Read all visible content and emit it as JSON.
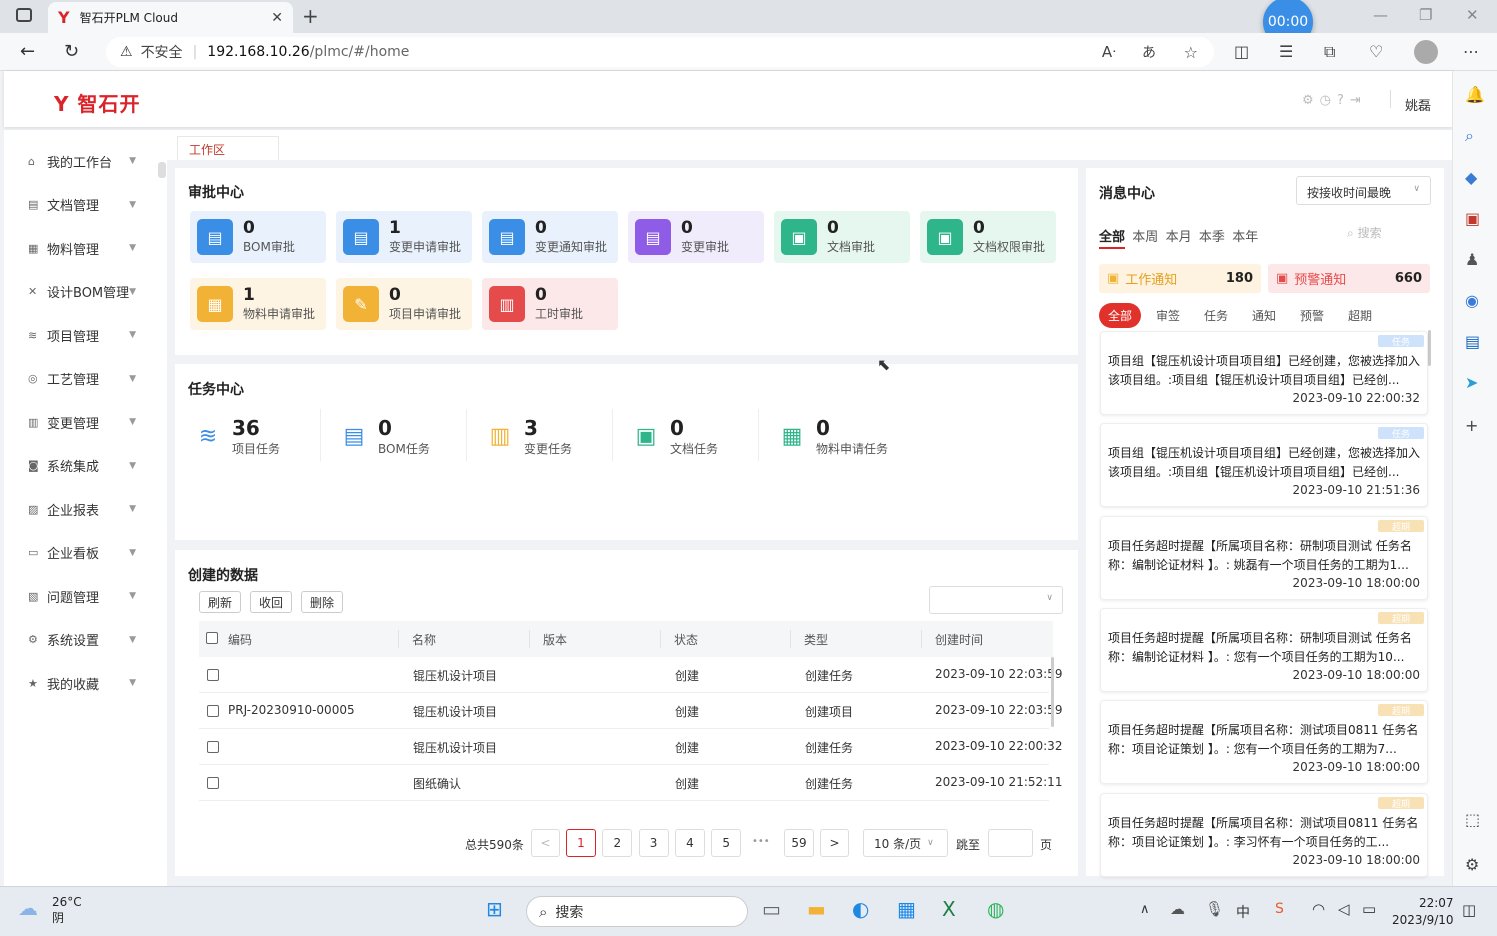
{
  "browser": {
    "tab_title": "智石开PLM Cloud",
    "insecure_label": "不安全",
    "url_host": "192.168.10.26",
    "url_path": "/plmc/#/home",
    "timer": "00:00"
  },
  "header": {
    "logo": "智石开",
    "user": "姚磊"
  },
  "menu": [
    {
      "label": "我的工作台",
      "icon": "home-icon"
    },
    {
      "label": "文档管理",
      "icon": "document-icon"
    },
    {
      "label": "物料管理",
      "icon": "material-icon"
    },
    {
      "label": "设计BOM管理",
      "icon": "bom-icon"
    },
    {
      "label": "项目管理",
      "icon": "project-icon"
    },
    {
      "label": "工艺管理",
      "icon": "process-icon"
    },
    {
      "label": "变更管理",
      "icon": "change-icon"
    },
    {
      "label": "系统集成",
      "icon": "integration-icon"
    },
    {
      "label": "企业报表",
      "icon": "report-icon"
    },
    {
      "label": "企业看板",
      "icon": "dashboard-icon"
    },
    {
      "label": "问题管理",
      "icon": "issue-icon"
    },
    {
      "label": "系统设置",
      "icon": "settings-icon"
    },
    {
      "label": "我的收藏",
      "icon": "star-icon"
    }
  ],
  "workspace_tab": "工作区",
  "approval": {
    "title": "审批中心",
    "cards": [
      {
        "count": "0",
        "label": "BOM审批",
        "color": "#3a8ee6",
        "bg": "#e8f1fc"
      },
      {
        "count": "1",
        "label": "变更申请审批",
        "color": "#3a8ee6",
        "bg": "#e8f1fc"
      },
      {
        "count": "0",
        "label": "变更通知审批",
        "color": "#3a8ee6",
        "bg": "#e8f1fc"
      },
      {
        "count": "0",
        "label": "变更审批",
        "color": "#8e5ce6",
        "bg": "#f1ecfc"
      },
      {
        "count": "0",
        "label": "文档审批",
        "color": "#2fb58a",
        "bg": "#e6f7f0"
      },
      {
        "count": "0",
        "label": "文档权限审批",
        "color": "#2fb58a",
        "bg": "#e6f7f0"
      },
      {
        "count": "1",
        "label": "物料申请审批",
        "color": "#f2b235",
        "bg": "#fdf4e3"
      },
      {
        "count": "0",
        "label": "项目申请审批",
        "color": "#f2b235",
        "bg": "#fdf4e3"
      },
      {
        "count": "0",
        "label": "工时审批",
        "color": "#e64b4b",
        "bg": "#fce8e8"
      }
    ]
  },
  "tasks": {
    "title": "任务中心",
    "items": [
      {
        "count": "36",
        "label": "项目任务",
        "color": "#3a8ee6"
      },
      {
        "count": "0",
        "label": "BOM任务",
        "color": "#3a8ee6"
      },
      {
        "count": "3",
        "label": "变更任务",
        "color": "#f2b235"
      },
      {
        "count": "0",
        "label": "文档任务",
        "color": "#2fb58a"
      },
      {
        "count": "0",
        "label": "物料申请任务",
        "color": "#2fb58a"
      }
    ]
  },
  "created": {
    "title": "创建的数据",
    "buttons": {
      "refresh": "刷新",
      "recall": "收回",
      "delete": "删除"
    },
    "columns": [
      "编码",
      "名称",
      "版本",
      "状态",
      "类型",
      "创建时间"
    ],
    "rows": [
      {
        "code": "",
        "name": "锟压机设计项目",
        "version": "",
        "status": "创建",
        "type": "创建任务",
        "time": "2023-09-10 22:03:59"
      },
      {
        "code": "PRJ-20230910-00005",
        "name": "锟压机设计项目",
        "version": "",
        "status": "创建",
        "type": "创建项目",
        "time": "2023-09-10 22:03:59"
      },
      {
        "code": "",
        "name": "锟压机设计项目",
        "version": "",
        "status": "创建",
        "type": "创建任务",
        "time": "2023-09-10 22:00:32"
      },
      {
        "code": "",
        "name": "图纸确认",
        "version": "",
        "status": "创建",
        "type": "创建任务",
        "time": "2023-09-10 21:52:11"
      }
    ],
    "pagination": {
      "total": "总共590条",
      "pages": [
        "1",
        "2",
        "3",
        "4",
        "5"
      ],
      "ellipsis": "•••",
      "last": "59",
      "page_size": "10 条/页",
      "jump_label": "跳至",
      "page_unit": "页"
    }
  },
  "messages": {
    "title": "消息中心",
    "sort": "按接收时间最晚",
    "periods": [
      "全部",
      "本周",
      "本月",
      "本季",
      "本年"
    ],
    "search_placeholder": "搜索",
    "work_notice": {
      "label": "工作通知",
      "count": "180"
    },
    "warn_notice": {
      "label": "预警通知",
      "count": "660"
    },
    "filters": [
      "全部",
      "审签",
      "任务",
      "通知",
      "预警",
      "超期"
    ],
    "items": [
      {
        "tag": "任务",
        "tag_color": "#cfe2fb",
        "text": "项目组【锟压机设计项目项目组】已经创建，您被选择加入该项目组。:项目组【锟压机设计项目项目组】已经创...",
        "time": "2023-09-10 22:00:32"
      },
      {
        "tag": "任务",
        "tag_color": "#cfe2fb",
        "text": "项目组【锟压机设计项目项目组】已经创建，您被选择加入该项目组。:项目组【锟压机设计项目项目组】已经创...",
        "time": "2023-09-10 21:51:36"
      },
      {
        "tag": "超期",
        "tag_color": "#f8e1b5",
        "text": "项目任务超时提醒【所属项目名称：研制项目测试 任务名称：编制论证材料 】。: 姚磊有一个项目任务的工期为1...",
        "time": "2023-09-10 18:00:00"
      },
      {
        "tag": "超期",
        "tag_color": "#f8e1b5",
        "text": "项目任务超时提醒【所属项目名称：研制项目测试 任务名称：编制论证材料 】。: 您有一个项目任务的工期为10...",
        "time": "2023-09-10 18:00:00"
      },
      {
        "tag": "超期",
        "tag_color": "#f8e1b5",
        "text": "项目任务超时提醒【所属项目名称：测试项目0811 任务名称：项目论证策划 】。: 您有一个项目任务的工期为7...",
        "time": "2023-09-10 18:00:00"
      },
      {
        "tag": "超期",
        "tag_color": "#f8e1b5",
        "text": "项目任务超时提醒【所属项目名称：测试项目0811 任务名称：项目论证策划 】。: 李习怀有一个项目任务的工...",
        "time": "2023-09-10 18:00:00"
      }
    ]
  },
  "taskbar": {
    "temp": "26°C",
    "weather": "阴",
    "search": "搜索",
    "ime": "中",
    "time": "22:07",
    "date": "2023/9/10"
  }
}
